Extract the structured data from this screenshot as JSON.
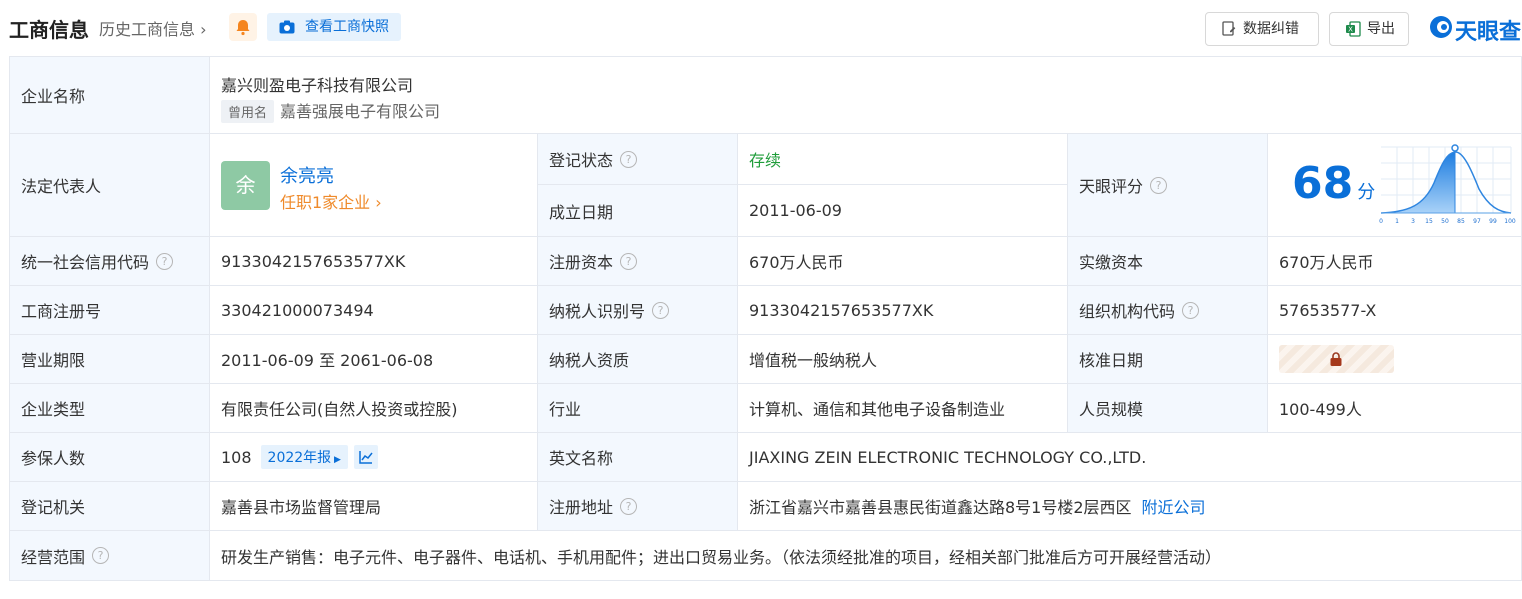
{
  "header": {
    "title": "工商信息",
    "history": "历史工商信息",
    "snapshot_label": "查看工商快照",
    "correct_label": "数据纠错",
    "export_label": "导出",
    "brand": "天眼查"
  },
  "rows": {
    "company_name": {
      "label": "企业名称",
      "value": "嘉兴则盈电子科技有限公司",
      "used_tag": "曾用名",
      "used_name": "嘉善强展电子有限公司"
    },
    "legal_rep": {
      "label": "法定代表人",
      "avatar_char": "余",
      "name": "余亮亮",
      "jobs": "任职1家企业"
    },
    "reg_status": {
      "label": "登记状态",
      "value": "存续"
    },
    "found_date": {
      "label": "成立日期",
      "value": "2011-06-09"
    },
    "tianyan_score": {
      "label": "天眼评分",
      "score": "68",
      "unit": "分"
    },
    "credit_code": {
      "label": "统一社会信用代码",
      "value": "9133042157653577XK"
    },
    "reg_capital": {
      "label": "注册资本",
      "value": "670万人民币"
    },
    "paid_capital": {
      "label": "实缴资本",
      "value": "670万人民币"
    },
    "reg_number": {
      "label": "工商注册号",
      "value": "330421000073494"
    },
    "taxpayer_id": {
      "label": "纳税人识别号",
      "value": "9133042157653577XK"
    },
    "org_code": {
      "label": "组织机构代码",
      "value": "57653577-X"
    },
    "biz_term": {
      "label": "营业期限",
      "value": "2011-06-09 至 2061-06-08"
    },
    "taxpayer_qual": {
      "label": "纳税人资质",
      "value": "增值税一般纳税人"
    },
    "approve_date": {
      "label": "核准日期"
    },
    "company_type": {
      "label": "企业类型",
      "value": "有限责任公司(自然人投资或控股)"
    },
    "industry": {
      "label": "行业",
      "value": "计算机、通信和其他电子设备制造业"
    },
    "staff_size": {
      "label": "人员规模",
      "value": "100-499人"
    },
    "insured": {
      "label": "参保人数",
      "value": "108",
      "year": "2022年报"
    },
    "english_name": {
      "label": "英文名称",
      "value": "JIAXING ZEIN ELECTRONIC TECHNOLOGY CO.,LTD."
    },
    "authority": {
      "label": "登记机关",
      "value": "嘉善县市场监督管理局"
    },
    "reg_address": {
      "label": "注册地址",
      "value": "浙江省嘉兴市嘉善县惠民街道鑫达路8号1号楼2层西区",
      "nearby": "附近公司"
    },
    "biz_scope": {
      "label": "经营范围",
      "value": "研发生产销售：电子元件、电子器件、电话机、手机用配件；进出口贸易业务。（依法须经批准的项目，经相关部门批准后方可开展经营活动）"
    }
  },
  "score_chart": {
    "ticks": [
      "0",
      "1",
      "3",
      "15",
      "50",
      "85",
      "97",
      "99",
      "100"
    ]
  },
  "colors": {
    "accent": "#0a6fd8",
    "status_green": "#1f9d3a",
    "orange": "#ef8a2a",
    "label_bg": "#f3f8fe"
  }
}
